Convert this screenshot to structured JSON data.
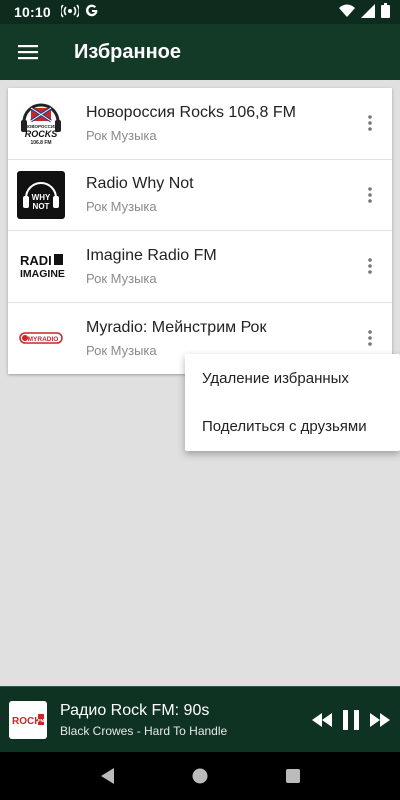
{
  "status_bar": {
    "time": "10:10",
    "icons": [
      "radio-icon",
      "google-g-icon",
      "wifi-icon",
      "signal-icon",
      "battery-icon"
    ]
  },
  "app_bar": {
    "title": "Избранное",
    "menu_icon": "hamburger-menu-icon"
  },
  "stations": [
    {
      "name": "Новороссия Rocks 106,8 FM",
      "genre": "Рок Музыка",
      "logo": "novorossiya-rocks-logo",
      "logo_text": [
        "НОВОРОССИЯ",
        "ROCKS",
        "106.8 FM"
      ]
    },
    {
      "name": "Radio Why Not",
      "genre": "Рок Музыка",
      "logo": "radio-why-not-logo",
      "logo_text": [
        "WHY",
        "NOT"
      ]
    },
    {
      "name": "Imagine Radio FM",
      "genre": "Рок Музыка",
      "logo": "imagine-radio-logo",
      "logo_text": [
        "RADI",
        "IMAGINE"
      ]
    },
    {
      "name": "Myradio: Мейнстрим Рок",
      "genre": "Рок Музыка",
      "logo": "myradio-logo",
      "logo_text": [
        "MYRADIO"
      ]
    }
  ],
  "popup_menu": {
    "items": [
      "Удаление избранных",
      "Поделиться с друзьями"
    ]
  },
  "player": {
    "title": "Радио Rock FM: 90s",
    "subtitle": "Black Crowes - Hard To Handle",
    "logo_text": [
      "ROCK",
      "FM"
    ]
  },
  "colors": {
    "status_bar": "#0e2c1e",
    "app_bar": "#123a26",
    "player": "#0f3322",
    "background": "#e0e0e0"
  }
}
